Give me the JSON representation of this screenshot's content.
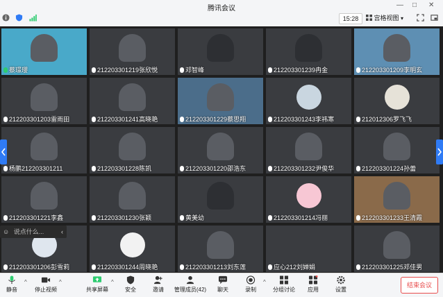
{
  "window": {
    "title": "腾讯会议",
    "controls": [
      "—",
      "□",
      "✕"
    ]
  },
  "topbar": {
    "time": "15:28",
    "view_label": "宫格视图"
  },
  "participants": [
    {
      "name": "蔡璟璎",
      "mic": "on"
    },
    {
      "name": "212203301219张欣悦",
      "mic": "off"
    },
    {
      "name": "邓智峰",
      "mic": "off"
    },
    {
      "name": "212203301239冉金",
      "mic": "off"
    },
    {
      "name": "212203301209李明玄",
      "mic": "off"
    },
    {
      "name": "212203301203雷雨田",
      "mic": "off"
    },
    {
      "name": "212203301241高晓艳",
      "mic": "off"
    },
    {
      "name": "212203301229蔡思翔",
      "mic": "off"
    },
    {
      "name": "212203301243李祎寒",
      "mic": "off"
    },
    {
      "name": "212012306罗飞飞",
      "mic": "off"
    },
    {
      "name": "杨鹏212203301211",
      "mic": "off"
    },
    {
      "name": "212203301228陈凯",
      "mic": "off"
    },
    {
      "name": "212203301220邵浩东",
      "mic": "off"
    },
    {
      "name": "212203301232尹俊华",
      "mic": "off"
    },
    {
      "name": "212203301224孙蕾",
      "mic": "off"
    },
    {
      "name": "212203301221李鑫",
      "mic": "off"
    },
    {
      "name": "212203301230张颖",
      "mic": "off"
    },
    {
      "name": "黄美幼",
      "mic": "off"
    },
    {
      "name": "212203301214冯丽",
      "mic": "off"
    },
    {
      "name": "212203301233王清霞",
      "mic": "off"
    },
    {
      "name": "212203301206彭雪莉",
      "mic": "off"
    },
    {
      "name": "212203301244周晓艳",
      "mic": "off"
    },
    {
      "name": "212203301213刘东莲",
      "mic": "off"
    },
    {
      "name": "应心212刘婵娟",
      "mic": "off"
    },
    {
      "name": "212203301225邓佳男",
      "mic": "off"
    }
  ],
  "chat": {
    "placeholder": "说点什么..."
  },
  "toolbar": {
    "mute": "静音",
    "video": "停止视频",
    "share": "共享屏幕",
    "security": "安全",
    "invite": "邀请",
    "members": "管理成员(42)",
    "chat": "聊天",
    "record": "录制",
    "breakout": "分组讨论",
    "apps": "应用",
    "settings": "设置",
    "end": "结束会议"
  },
  "colors": {
    "end_button": "#e84a4a",
    "toolbar_bg": "#f4f5f7",
    "accent": "#2f7bf5"
  }
}
